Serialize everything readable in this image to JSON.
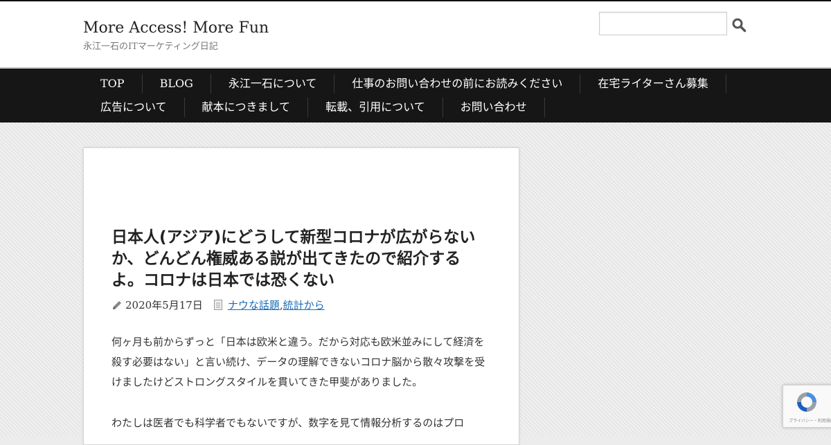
{
  "header": {
    "site_title": "More Access! More Fun",
    "site_description": "永江一石のITマーケティング日記",
    "search_placeholder": ""
  },
  "nav": {
    "row1": [
      "TOP",
      "BLOG",
      "永江一石について",
      "仕事のお問い合わせの前にお読みください",
      "在宅ライターさん募集"
    ],
    "row2": [
      "広告について",
      "献本につきまして",
      "転載、引用について",
      "お問い合わせ"
    ]
  },
  "post": {
    "title": "日本人(アジア)にどうして新型コロナが広がらないか、どんどん権威ある説が出てきたので紹介するよ。コロナは日本では恐くない",
    "date": "2020年5月17日",
    "categories": [
      "ナウな話題",
      "統計から"
    ],
    "category_separator": ", ",
    "paragraphs": [
      "何ヶ月も前からずっと「日本は欧米と違う。だから対応も欧米並みにして経済を殺す必要はない」と言い続け、データの理解できないコロナ脳から散々攻撃を受けましたけどストロングスタイルを貫いてきた甲斐がありました。",
      "わたしは医者でも科学者でもないですが、数字を見て情報分析するのはプロ"
    ]
  },
  "recaptcha": {
    "label": "プライバシー・利用規約"
  },
  "icons": {
    "search": "search-icon",
    "pencil": "pencil-icon",
    "category": "document-icon",
    "recaptcha": "recaptcha-icon"
  },
  "colors": {
    "nav_background": "#161616",
    "link": "#1a6bb8",
    "page_background": "#ebebeb"
  }
}
